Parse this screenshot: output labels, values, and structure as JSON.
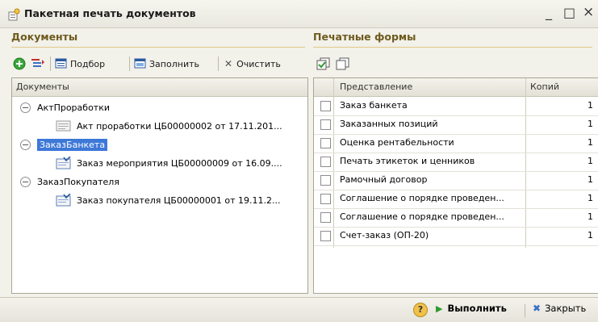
{
  "window": {
    "title": "Пакетная печать документов",
    "controls": {
      "minimize": "_",
      "maximize": "□",
      "close": "×"
    }
  },
  "documents": {
    "section_title": "Документы",
    "toolbar": {
      "select_label": "Подбор",
      "fill_label": "Заполнить",
      "clear_label": "Очистить"
    },
    "column_header": "Документы",
    "tree": [
      {
        "label": "АктПроработки",
        "children": [
          "Акт проработки ЦБ00000002 от 17.11.201..."
        ]
      },
      {
        "label": "ЗаказБанкета",
        "selected": true,
        "children": [
          "Заказ мероприятия ЦБ00000009 от 16.09...."
        ]
      },
      {
        "label": "ЗаказПокупателя",
        "children": [
          "Заказ покупателя ЦБ00000001 от 19.11.2..."
        ]
      }
    ]
  },
  "print_forms": {
    "section_title": "Печатные формы",
    "columns": {
      "name": "Представление",
      "copies": "Копий"
    },
    "rows": [
      {
        "name": "Заказ банкета",
        "copies": "1"
      },
      {
        "name": "Заказанных позиций",
        "copies": "1"
      },
      {
        "name": "Оценка рентабельности",
        "copies": "1"
      },
      {
        "name": "Печать этикеток и ценников",
        "copies": "1"
      },
      {
        "name": "Рамочный договор",
        "copies": "1"
      },
      {
        "name": "Соглашение о порядке проведен...",
        "copies": "1"
      },
      {
        "name": "Соглашение о порядке проведен...",
        "copies": "1"
      },
      {
        "name": "Счет-заказ (ОП-20)",
        "copies": "1"
      }
    ]
  },
  "footer": {
    "help_label": "?",
    "execute_label": "Выполнить",
    "close_label": "Закрыть"
  },
  "colors": {
    "selection": "#3d78d8",
    "section_title": "#6f5a1e",
    "accent_green": "#2f9a2f"
  }
}
